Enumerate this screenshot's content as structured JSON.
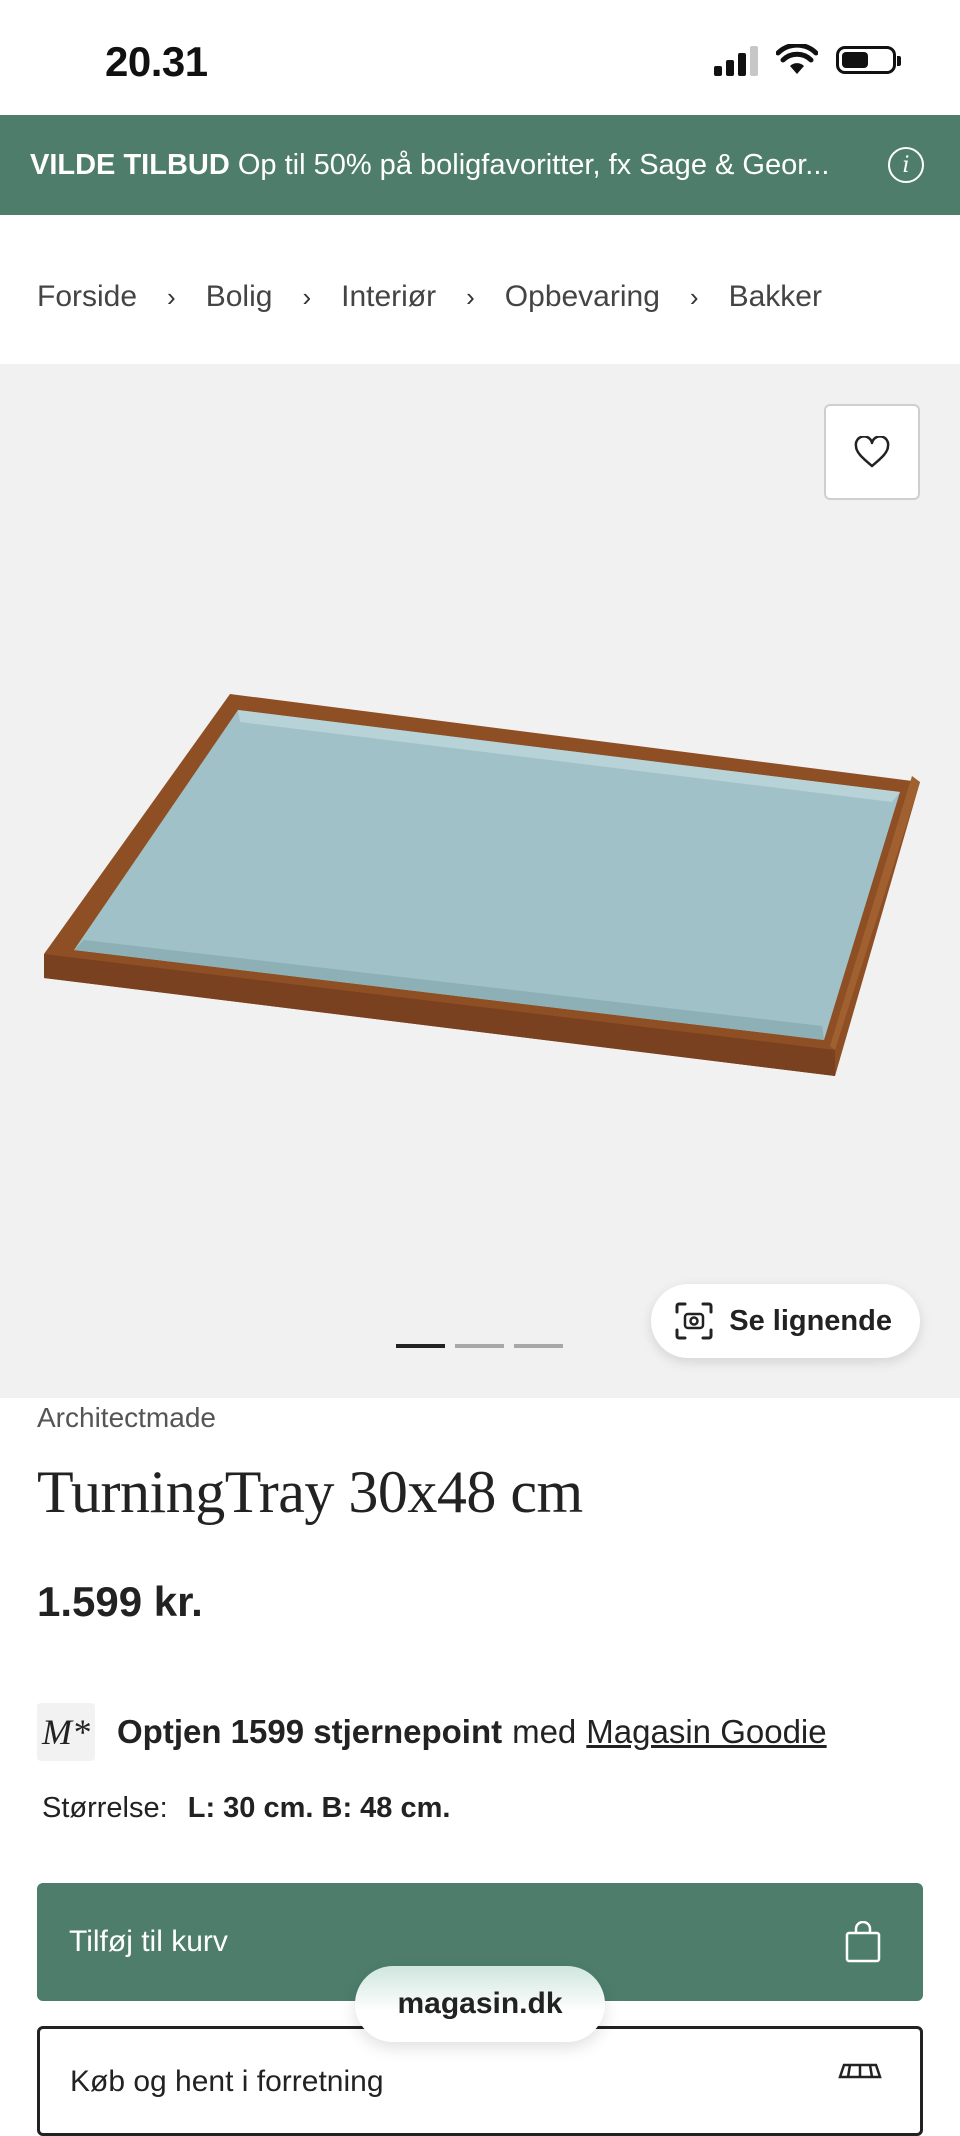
{
  "status_bar": {
    "time": "20.31",
    "signal_icon": "cellular-signal-icon",
    "wifi_icon": "wifi-icon",
    "battery_icon": "battery-icon",
    "battery_level": 0.55
  },
  "promo": {
    "bold": "VILDE TILBUD",
    "text": "Op til 50% på boligfavoritter, fx Sage & Geor...",
    "info_icon": "info-icon"
  },
  "breadcrumb": {
    "items": [
      "Forside",
      "Bolig",
      "Interiør",
      "Opbevaring",
      "Bakker"
    ],
    "separator": "›"
  },
  "gallery": {
    "favorite_icon": "heart-icon",
    "similar_label": "Se lignende",
    "similar_icon": "visual-search-icon",
    "image_count": 3,
    "active_index": 0,
    "colors": {
      "tray_wood": "#9a5a2e",
      "tray_surface": "#9fc1c7",
      "background": "#f1f1f1"
    }
  },
  "product": {
    "brand": "Architectmade",
    "title": "TurningTray 30x48 cm",
    "price": "1.599 kr."
  },
  "goodie": {
    "logo": "M*",
    "bold": "Optjen 1599 stjernepoint",
    "mid": "med",
    "link": "Magasin Goodie"
  },
  "size": {
    "label": "Størrelse:",
    "value": "L: 30 cm. B: 48 cm."
  },
  "cart": {
    "add_label": "Tilføj til kurv",
    "bag_icon": "shopping-bag-icon",
    "store_label": "Køb og hent i forretning",
    "store_icon": "store-icon"
  },
  "browser": {
    "url": "magasin.dk"
  },
  "colors": {
    "brand_green": "#4e7d6c"
  }
}
